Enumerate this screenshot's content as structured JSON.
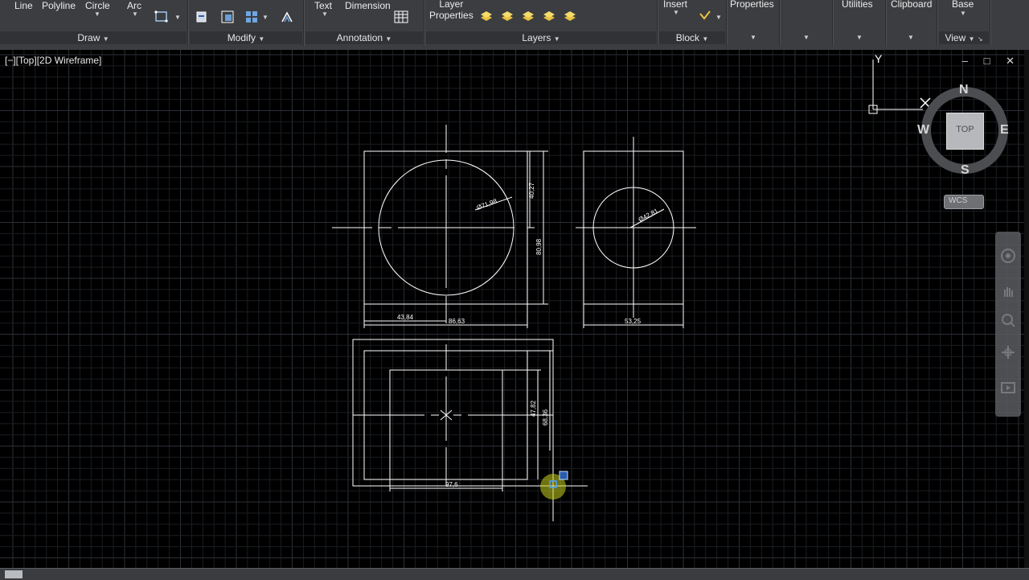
{
  "ribbon": {
    "draw": {
      "title": "Draw",
      "tools": {
        "line": "Line",
        "polyline": "Polyline",
        "circle": "Circle",
        "arc": "Arc"
      }
    },
    "modify": {
      "title": "Modify"
    },
    "annotation": {
      "title": "Annotation",
      "tools": {
        "text": "Text",
        "dimension": "Dimension"
      }
    },
    "layers": {
      "title": "Layers",
      "tools": {
        "layer_properties_1": "Layer",
        "layer_properties_2": "Properties"
      }
    },
    "block": {
      "title": "Block",
      "tools": {
        "insert": "Insert"
      }
    },
    "properties": {
      "label": "Properties"
    },
    "utilities": {
      "label": "Utilities"
    },
    "clipboard": {
      "label": "Clipboard"
    },
    "view": {
      "base_label": "Base",
      "title": "View"
    }
  },
  "viewport": {
    "label": "[−][Top][2D Wireframe]",
    "window_controls": "– □ ✕"
  },
  "ucs": {
    "y_label": "Y"
  },
  "viewcube": {
    "north": "N",
    "south": "S",
    "east": "E",
    "west": "W",
    "face": "TOP",
    "coord": "WCS"
  },
  "drawing": {
    "dims": {
      "front_dia": "Ø71,98",
      "front_h1": "40,27",
      "front_h2": "80,98",
      "front_w1": "43,84",
      "front_w2": "86,63",
      "side_dia": "Ø42,81",
      "side_w": "53,25",
      "plan_h1": "47,82",
      "plan_h2": "68,36",
      "plan_w": "97,6"
    }
  },
  "colors": {
    "ribbon_bg": "#3b3d40",
    "canvas_bg": "#000000",
    "grid_minor": "#1a1d22",
    "grid_major": "#2b2f36",
    "line": "#ffffff",
    "cursor_highlight": "#c8d21e"
  }
}
